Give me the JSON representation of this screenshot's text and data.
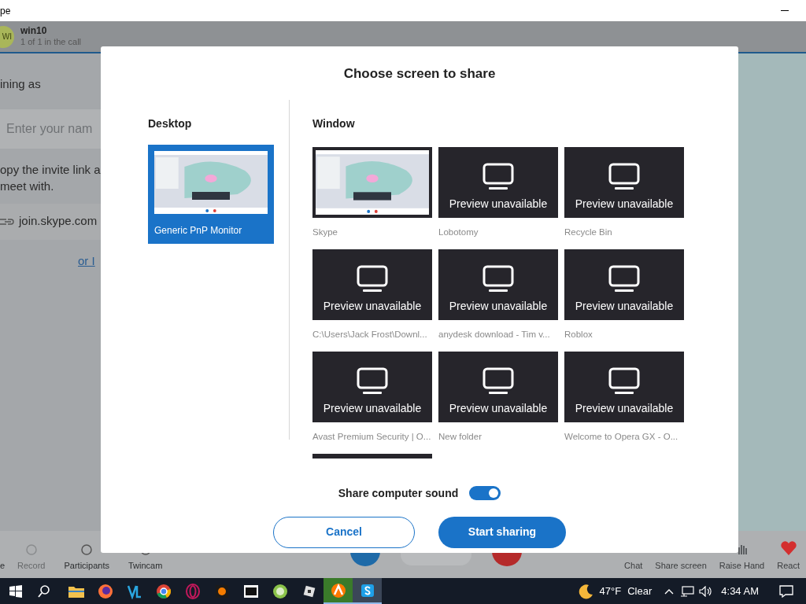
{
  "app_window": {
    "title": "pe"
  },
  "call_header": {
    "avatar": "WI",
    "name": "win10",
    "status": "1 of 1 in the call"
  },
  "join_panel": {
    "heading": "ining as",
    "name_placeholder": "Enter your nam",
    "invite_lines": [
      "opy the invite link a",
      "meet with."
    ],
    "link": "join.skype.com",
    "alt_link": "or I"
  },
  "call_toolbar": {
    "left": [
      {
        "label": "e",
        "disabled": false
      },
      {
        "label": "Record",
        "disabled": true
      },
      {
        "label": "Participants",
        "disabled": false
      },
      {
        "label": "Twincam",
        "disabled": false
      }
    ],
    "right": [
      {
        "label": "Chat",
        "kind": "covered"
      },
      {
        "label": "Share screen",
        "kind": "covered"
      },
      {
        "label": "Raise Hand",
        "kind": "hand"
      },
      {
        "label": "React",
        "kind": "heart"
      }
    ]
  },
  "dialog": {
    "title": "Choose screen to share",
    "desktop": {
      "heading": "Desktop",
      "items": [
        {
          "label": "Generic PnP Monitor",
          "selected": true
        }
      ]
    },
    "window": {
      "heading": "Window",
      "rows": [
        [
          {
            "label": "Skype",
            "kind": "preview",
            "selected": false
          },
          {
            "label": "Lobotomy",
            "kind": "unavailable",
            "message": "Preview unavailable",
            "selected": false
          },
          {
            "label": "Recycle Bin",
            "kind": "unavailable",
            "message": "Preview unavailable",
            "selected": false
          }
        ],
        [
          {
            "label": "C:\\Users\\Jack Frost\\Downl...",
            "kind": "unavailable",
            "message": "Preview unavailable",
            "selected": false
          },
          {
            "label": "anydesk download - Tim v...",
            "kind": "unavailable",
            "message": "Preview unavailable",
            "selected": false
          },
          {
            "label": "Roblox",
            "kind": "unavailable",
            "message": "Preview unavailable",
            "selected": false
          }
        ],
        [
          {
            "label": "Avast Premium Security | O...",
            "kind": "unavailable",
            "message": "Preview unavailable",
            "selected": false
          },
          {
            "label": "New folder",
            "kind": "unavailable",
            "message": "Preview unavailable",
            "selected": false
          },
          {
            "label": "Welcome to Opera GX - O...",
            "kind": "unavailable",
            "message": "Preview unavailable",
            "selected": false
          }
        ]
      ]
    },
    "sound": {
      "label": "Share computer sound",
      "on": true
    },
    "buttons": [
      {
        "label": "Cancel",
        "kind": "secondary"
      },
      {
        "label": "Start sharing",
        "kind": "primary"
      }
    ]
  },
  "taskbar": {
    "apps": [
      {
        "kind": "folder",
        "active": false
      },
      {
        "kind": "fox",
        "active": false
      },
      {
        "kind": "code",
        "active": false
      },
      {
        "kind": "chrome",
        "active": false
      },
      {
        "kind": "ring",
        "active": false
      },
      {
        "kind": "flame",
        "active": false
      },
      {
        "kind": "archive",
        "active": false
      },
      {
        "kind": "lime",
        "active": false
      },
      {
        "kind": "cube",
        "active": false
      },
      {
        "kind": "avast",
        "active": true
      },
      {
        "kind": "skype",
        "active": true
      }
    ],
    "weather": {
      "temp": "47°F",
      "condition": "Clear"
    },
    "time": "4:34 AM"
  }
}
